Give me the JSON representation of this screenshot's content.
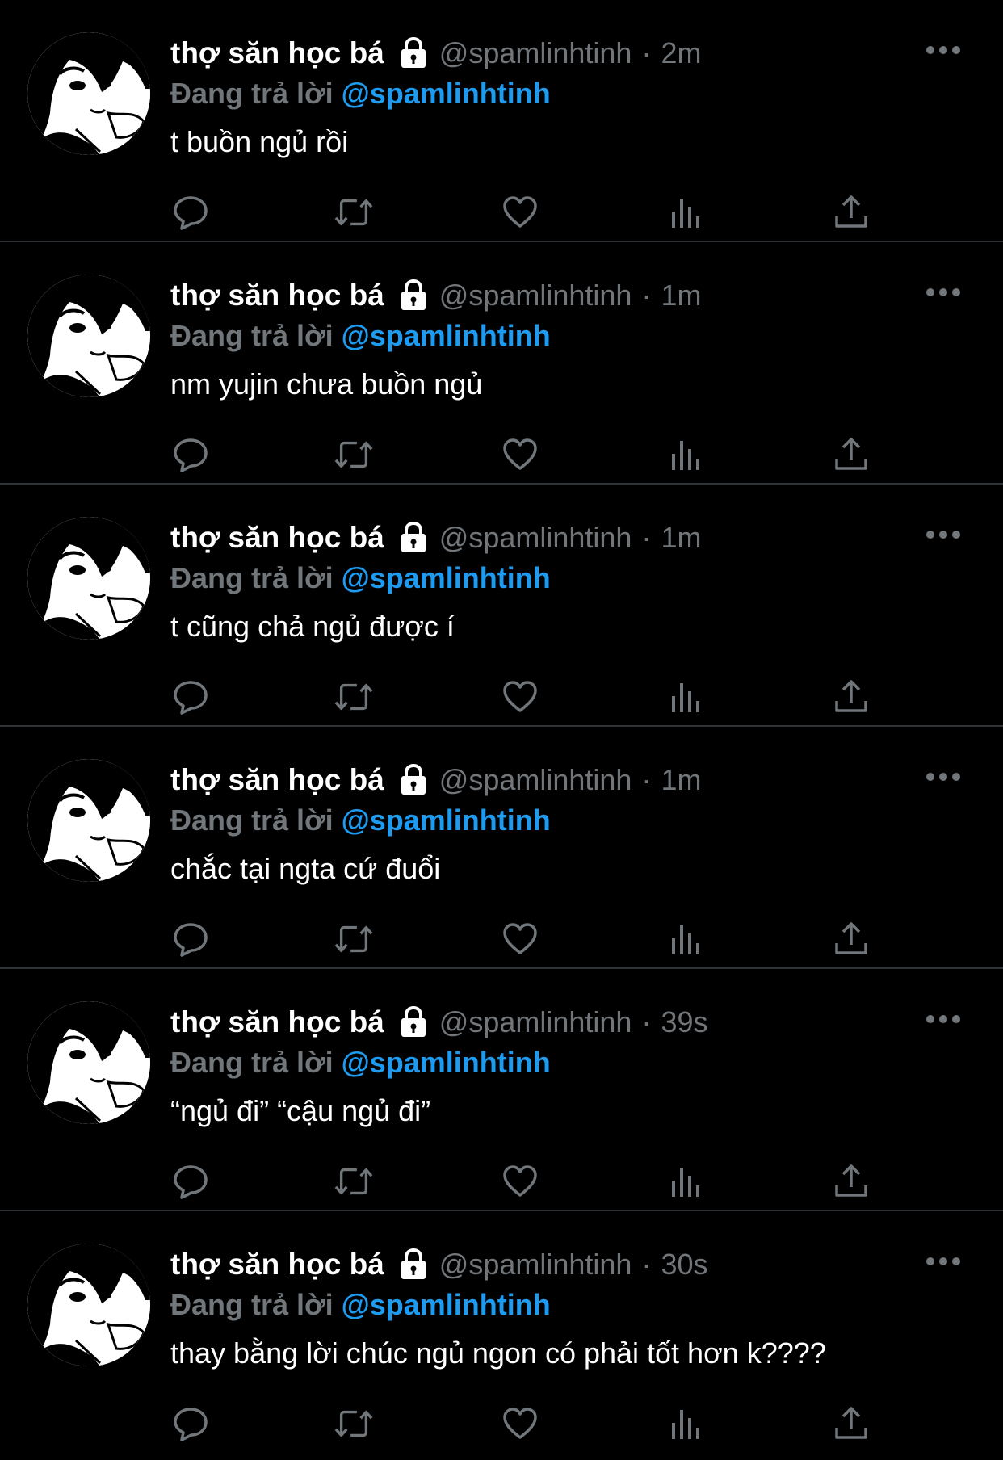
{
  "colors": {
    "background": "#000000",
    "divider": "#2f3336",
    "secondary_text": "#71767b",
    "accent": "#1d9bf0",
    "primary_text": "#ffffff"
  },
  "tweets": [
    {
      "display_name": "thợ săn học bá",
      "protected_icon": "lock-icon",
      "handle": "@spamlinhtinh",
      "separator": "·",
      "time": "2m",
      "reply_prefix": "Đang trả lời",
      "reply_to": "@spamlinhtinh",
      "text": "t buồn ngủ rồi"
    },
    {
      "display_name": "thợ săn học bá",
      "protected_icon": "lock-icon",
      "handle": "@spamlinhtinh",
      "separator": "·",
      "time": "1m",
      "reply_prefix": "Đang trả lời",
      "reply_to": "@spamlinhtinh",
      "text": "nm yujin chưa buồn ngủ"
    },
    {
      "display_name": "thợ săn học bá",
      "protected_icon": "lock-icon",
      "handle": "@spamlinhtinh",
      "separator": "·",
      "time": "1m",
      "reply_prefix": "Đang trả lời",
      "reply_to": "@spamlinhtinh",
      "text": "t cũng chả ngủ được í"
    },
    {
      "display_name": "thợ săn học bá",
      "protected_icon": "lock-icon",
      "handle": "@spamlinhtinh",
      "separator": "·",
      "time": "1m",
      "reply_prefix": "Đang trả lời",
      "reply_to": "@spamlinhtinh",
      "text": "chắc tại ngta cứ đuổi"
    },
    {
      "display_name": "thợ săn học bá",
      "protected_icon": "lock-icon",
      "handle": "@spamlinhtinh",
      "separator": "·",
      "time": "39s",
      "reply_prefix": "Đang trả lời",
      "reply_to": "@spamlinhtinh",
      "text": "“ngủ đi” “cậu ngủ đi”"
    },
    {
      "display_name": "thợ săn học bá",
      "protected_icon": "lock-icon",
      "handle": "@spamlinhtinh",
      "separator": "·",
      "time": "30s",
      "reply_prefix": "Đang trả lời",
      "reply_to": "@spamlinhtinh",
      "text": "thay bằng lời chúc ngủ ngon có phải tốt hơn k????"
    }
  ],
  "action_icons": [
    "reply-icon",
    "retweet-icon",
    "like-icon",
    "views-icon",
    "share-icon"
  ]
}
